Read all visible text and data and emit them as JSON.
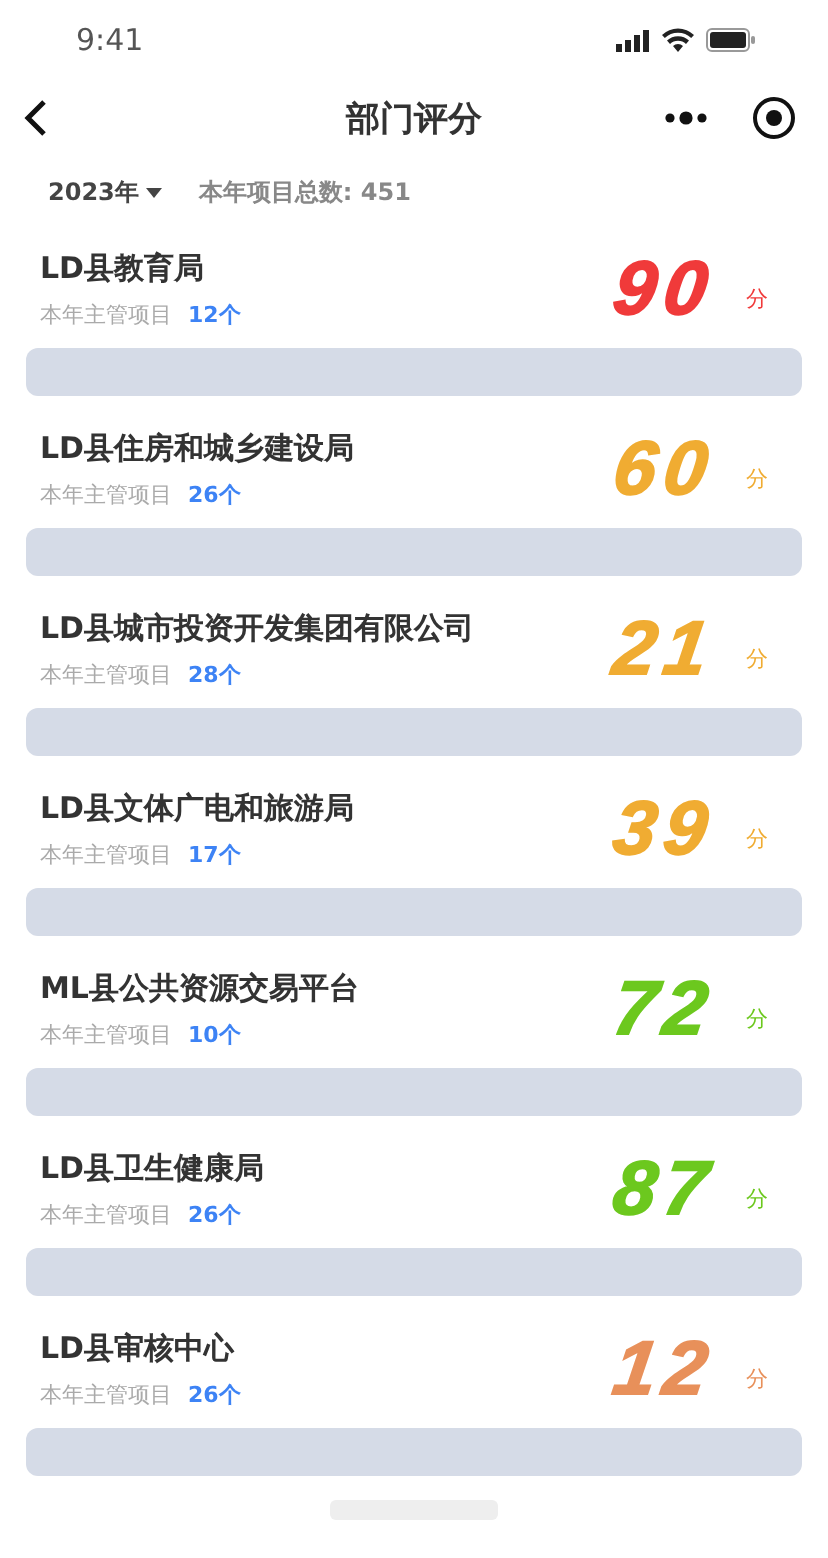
{
  "status_bar": {
    "time": "9:41"
  },
  "nav": {
    "title": "部门评分"
  },
  "filter": {
    "year": "2023年",
    "total_label": "本年项目总数:",
    "total": "451"
  },
  "departments": [
    {
      "name": "LD县教育局",
      "sub_label": "本年主管项目",
      "count": "12个",
      "score": "90",
      "unit": "分",
      "color": "#f03a3a"
    },
    {
      "name": "LD县住房和城乡建设局",
      "sub_label": "本年主管项目",
      "count": "26个",
      "score": "60",
      "unit": "分",
      "color": "#f0ac32"
    },
    {
      "name": "LD县城市投资开发集团有限公司",
      "sub_label": "本年主管项目",
      "count": "28个",
      "score": "21",
      "unit": "分",
      "color": "#f0ac32"
    },
    {
      "name": "LD县文体广电和旅游局",
      "sub_label": "本年主管项目",
      "count": "17个",
      "score": "39",
      "unit": "分",
      "color": "#f0ac32"
    },
    {
      "name": "ML县公共资源交易平台",
      "sub_label": "本年主管项目",
      "count": "10个",
      "score": "72",
      "unit": "分",
      "color": "#6cc81e"
    },
    {
      "name": "LD县卫生健康局",
      "sub_label": "本年主管项目",
      "count": "26个",
      "score": "87",
      "unit": "分",
      "color": "#6cc81e"
    },
    {
      "name": "LD县审核中心",
      "sub_label": "本年主管项目",
      "count": "26个",
      "score": "12",
      "unit": "分",
      "color": "#e8905a"
    }
  ]
}
